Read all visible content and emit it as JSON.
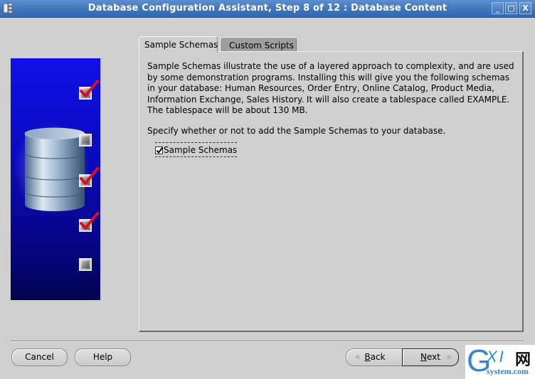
{
  "window": {
    "title": "Database Configuration Assistant, Step 8 of 12 : Database Content",
    "controls": {
      "minimize": "_",
      "maximize": "□",
      "close": "X"
    }
  },
  "sidebar": {
    "steps": [
      {
        "state": "checked"
      },
      {
        "state": "unchecked"
      },
      {
        "state": "checked"
      },
      {
        "state": "checked"
      },
      {
        "state": "unchecked"
      }
    ]
  },
  "tabs": [
    {
      "label": "Sample Schemas",
      "active": true
    },
    {
      "label": "Custom Scripts",
      "active": false
    }
  ],
  "content": {
    "description": "Sample Schemas illustrate the use of a layered approach to complexity, and are used by some demonstration programs. Installing this will give you the following schemas in your database: Human Resources, Order Entry, Online Catalog, Product Media, Information Exchange, Sales History. It will also create a tablespace called EXAMPLE. The tablespace will be about 130 MB.",
    "specify": "Specify whether or not to add the Sample Schemas to your database.",
    "checkbox": {
      "label": "Sample Schemas",
      "checked": true
    }
  },
  "buttons": {
    "cancel": "Cancel",
    "help": "Help",
    "back": "Back",
    "back_mnemonic": "B",
    "back_rest": "ack",
    "next": "Next",
    "next_mnemonic": "N",
    "next_rest": "ext",
    "back_arrow": "«",
    "next_arrow": "»"
  },
  "watermark": {
    "g": "G",
    "xi": "XI",
    "wang": "网",
    "domain": "system.com"
  },
  "colors": {
    "titlebar": "#3f72b8",
    "sidebar_top": "#1010e8",
    "sidebar_bottom": "#03034f",
    "check_red": "#d81020",
    "background": "#cfcfcf"
  }
}
